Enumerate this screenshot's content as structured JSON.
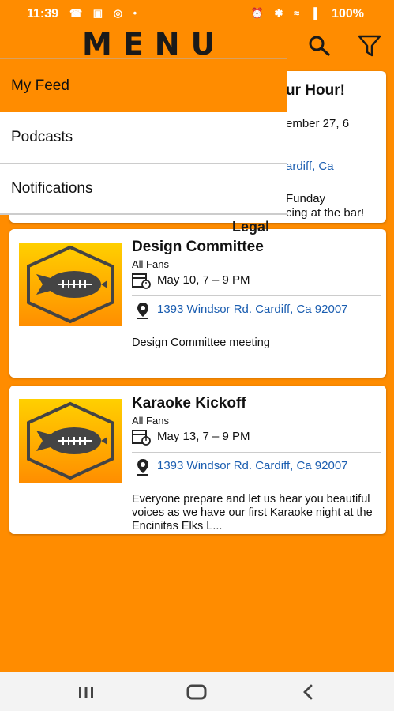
{
  "status_bar": {
    "time": "11:39",
    "left_icons": "☎ ▣ ◎ •",
    "right_icons": "⏰ ✱ ≈ ▐",
    "battery": "100%"
  },
  "header": {
    "title": "MENU",
    "icons": [
      "search-icon",
      "filter-icon"
    ]
  },
  "drawer": {
    "items": [
      {
        "label": "My Feed",
        "active": true
      },
      {
        "label": "Podcasts",
        "active": false
      },
      {
        "label": "Notifications",
        "active": false
      }
    ],
    "legal": "Legal"
  },
  "partial_card": {
    "title_fragment": "ur Hour!",
    "date_fragment": "ember 27, 6",
    "address_fragment": "ardiff, Ca",
    "desc_fragment_1": "Funday",
    "desc_fragment_2": "cing at the bar!"
  },
  "events": [
    {
      "title": "Design Committee",
      "category": "All Fans",
      "date": "May 10, 7 – 9 PM",
      "address": "1393 Windsor Rd. Cardiff, Ca 92007",
      "description": "Design Committee meeting"
    },
    {
      "title": "Karaoke Kickoff",
      "category": "All Fans",
      "date": "May 13, 7 – 9 PM",
      "address": "1393 Windsor Rd. Cardiff, Ca 92007",
      "description": "Everyone prepare and let us hear you beautiful voices as we have our first Karaoke night at the Encinitas Elks L..."
    }
  ],
  "nav_bar": {
    "buttons": [
      "recent-apps-icon",
      "home-icon",
      "back-icon"
    ]
  },
  "colors": {
    "background": "#FF8C00",
    "drawer_active": "#FF8C00",
    "link": "#1a5db0"
  }
}
